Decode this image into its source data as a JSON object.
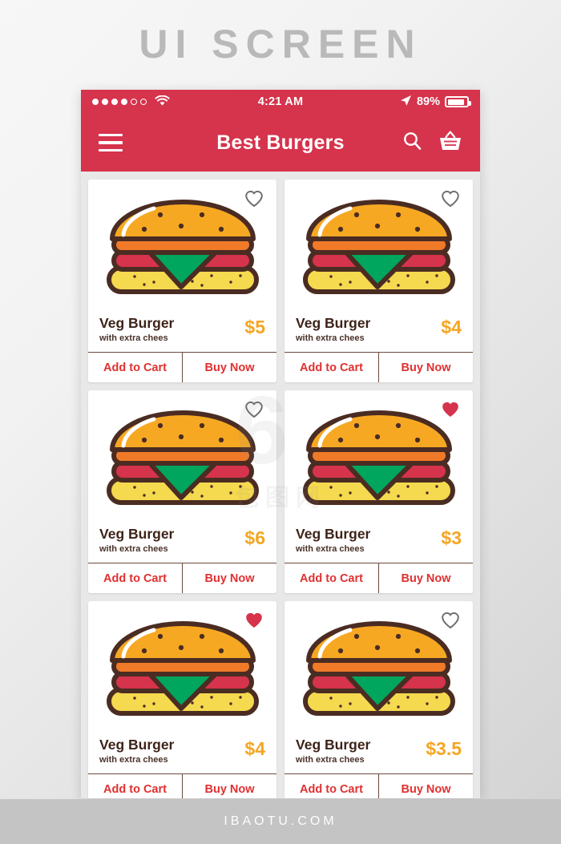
{
  "poster": {
    "title": "UI SCREEN",
    "footer": "IBAOTU.COM",
    "watermark": "6",
    "watermark_sub": "包图网"
  },
  "colors": {
    "brand_red": "#d6334c",
    "price_amber": "#f5a623",
    "action_red": "#e03030",
    "outline_brown": "#4a2c22",
    "bun_top": "#f7a823",
    "patty_orange": "#f07a28",
    "tomato_red": "#d6334c",
    "lettuce_green": "#00a55e",
    "bun_bottom": "#f5d94f",
    "heart_filled": "#d6334c",
    "heart_outline": "#6e6e6e"
  },
  "statusbar": {
    "signal_dots_total": 6,
    "signal_dots_filled": 4,
    "wifi_icon": "wifi-icon",
    "time": "4:21 AM",
    "location_icon": "location-arrow-icon",
    "battery_percent": "89%",
    "battery_level": 89,
    "battery_icon": "battery-icon"
  },
  "appbar": {
    "menu_icon": "hamburger-menu-icon",
    "title": "Best Burgers",
    "search_icon": "search-icon",
    "cart_icon": "shopping-basket-icon"
  },
  "labels": {
    "add_to_cart": "Add to Cart",
    "buy_now": "Buy Now"
  },
  "products": [
    {
      "name": "Veg Burger",
      "subtitle": "with extra chees",
      "price": "$5",
      "favorite": false,
      "image": "burger-illustration",
      "add_to_cart": "Add to Cart",
      "buy_now": "Buy Now"
    },
    {
      "name": "Veg Burger",
      "subtitle": "with extra chees",
      "price": "$4",
      "favorite": false,
      "image": "burger-illustration",
      "add_to_cart": "Add to Cart",
      "buy_now": "Buy Now"
    },
    {
      "name": "Veg Burger",
      "subtitle": "with extra chees",
      "price": "$6",
      "favorite": false,
      "image": "burger-illustration",
      "add_to_cart": "Add to Cart",
      "buy_now": "Buy Now"
    },
    {
      "name": "Veg Burger",
      "subtitle": "with extra chees",
      "price": "$3",
      "favorite": true,
      "image": "burger-illustration",
      "add_to_cart": "Add to Cart",
      "buy_now": "Buy Now"
    },
    {
      "name": "Veg Burger",
      "subtitle": "with extra chees",
      "price": "$4",
      "favorite": true,
      "image": "burger-illustration",
      "add_to_cart": "Add to Cart",
      "buy_now": "Buy Now"
    },
    {
      "name": "Veg Burger",
      "subtitle": "with extra chees",
      "price": "$3.5",
      "favorite": false,
      "image": "burger-illustration",
      "add_to_cart": "Add to Cart",
      "buy_now": "Buy Now"
    }
  ]
}
